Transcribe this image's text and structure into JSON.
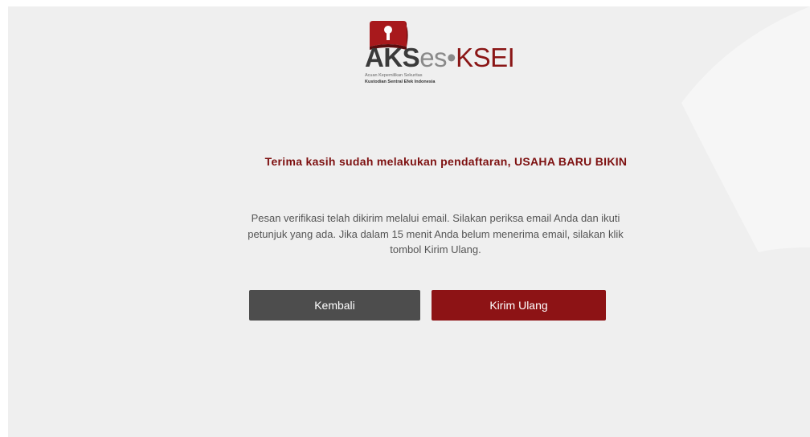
{
  "logo": {
    "part1": "AKS",
    "part2": "es",
    "separator": "•",
    "part3": "KSEI",
    "subtitle1": "Acuan Kepemilikan Sekuritas",
    "subtitle2": "Kustodian Sentral Efek Indonesia",
    "icon": "keyhole-icon"
  },
  "heading": "Terima kasih sudah melakukan pendaftaran, USAHA BARU BIKIN",
  "message": "Pesan verifikasi telah dikirim melalui email. Silakan periksa email Anda dan ikuti petunjuk yang ada. Jika dalam 15 menit Anda belum menerima email, silakan klik tombol Kirim Ulang.",
  "buttons": {
    "back": "Kembali",
    "resend": "Kirim Ulang"
  },
  "colors": {
    "brand_red": "#8d1315",
    "heading_red": "#7d1010",
    "button_gray": "#4d4d4d",
    "background": "#efefef"
  }
}
